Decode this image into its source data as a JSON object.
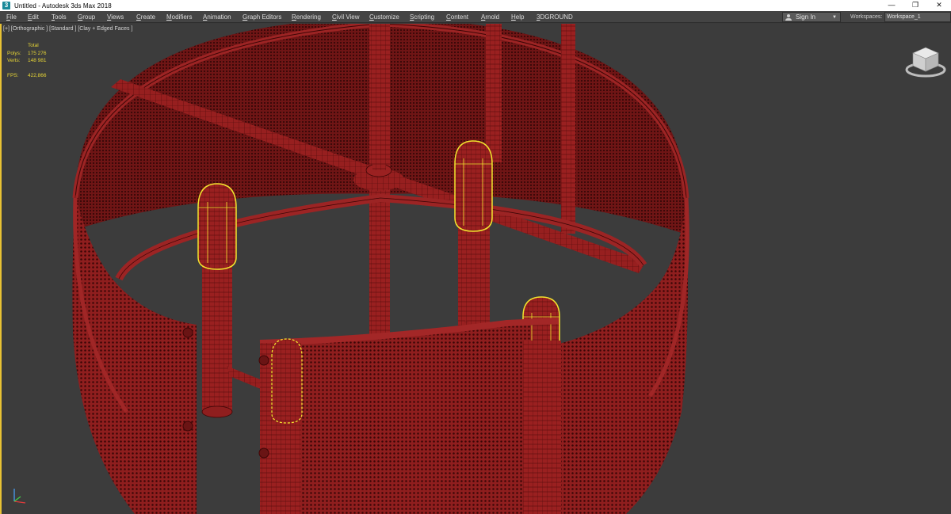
{
  "window": {
    "title": "Untitled - Autodesk 3ds Max 2018",
    "app_icon": "3ds-max-icon",
    "controls": [
      "minimize-icon",
      "restore-icon",
      "close-icon"
    ]
  },
  "menubar": {
    "items": [
      "File",
      "Edit",
      "Tools",
      "Group",
      "Views",
      "Create",
      "Modifiers",
      "Animation",
      "Graph Editors",
      "Rendering",
      "Civil View",
      "Customize",
      "Scripting",
      "Content",
      "Arnold",
      "Help",
      "3DGROUND"
    ],
    "signin_label": "Sign In",
    "workspaces_label": "Workspaces:",
    "workspace_value": "Workspace_1"
  },
  "viewport": {
    "label": "[+] [Orthographic ] [Standard ] [Clay + Edged Faces ]",
    "stats": {
      "header": "Total",
      "polys_label": "Polys:",
      "polys_value": "175 276",
      "verts_label": "Verts:",
      "verts_value": "148 981",
      "fps_label": "FPS:",
      "fps_value": "422,866"
    },
    "colors": {
      "background": "#3c3c3c",
      "mesh": "#8f1e1e",
      "wire": "#3d0606",
      "selection": "#f2e52e",
      "active_border": "#e8c234"
    },
    "icons": [
      "viewcube-icon",
      "axis-tripod-icon"
    ]
  }
}
